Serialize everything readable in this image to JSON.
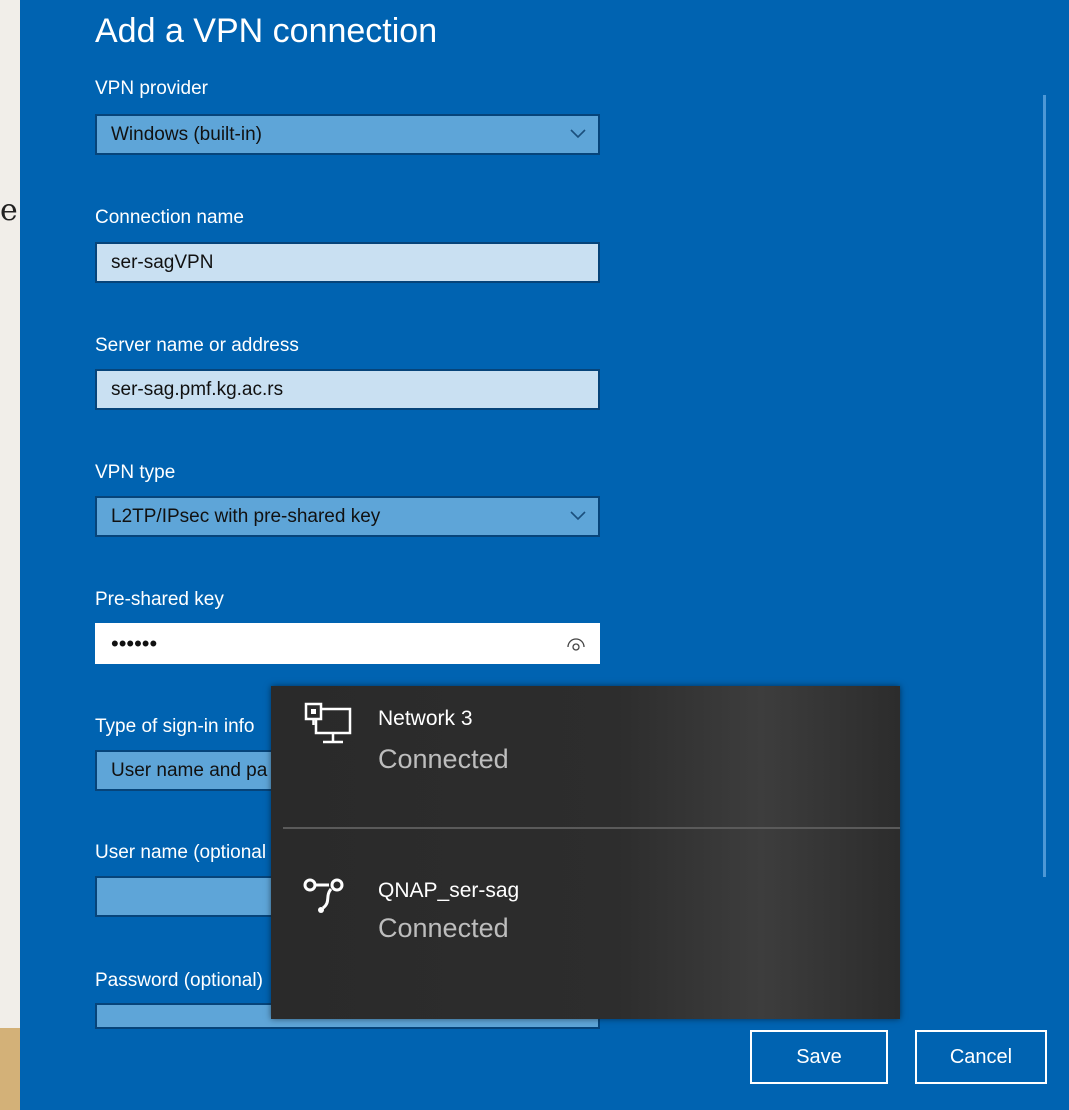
{
  "dialog": {
    "title": "Add a VPN connection",
    "fields": {
      "vpn_provider": {
        "label": "VPN provider",
        "value": "Windows (built-in)"
      },
      "connection_name": {
        "label": "Connection name",
        "value": "ser-sagVPN"
      },
      "server_name": {
        "label": "Server name or address",
        "value": "ser-sag.pmf.kg.ac.rs"
      },
      "vpn_type": {
        "label": "VPN type",
        "value": "L2TP/IPsec with pre-shared key"
      },
      "pre_shared_key": {
        "label": "Pre-shared key",
        "value": "••••••"
      },
      "sign_in_type": {
        "label": "Type of sign-in info",
        "value": "User name and pa"
      },
      "user_name": {
        "label": "User name (optional",
        "value": ""
      },
      "password": {
        "label": "Password (optional)",
        "value": ""
      }
    },
    "buttons": {
      "save": "Save",
      "cancel": "Cancel"
    }
  },
  "background": {
    "partial_letter": "e"
  },
  "network_flyout": {
    "networks": [
      {
        "name": "Network 3",
        "status": "Connected",
        "icon": "wired-network-icon"
      },
      {
        "name": "QNAP_ser-sag",
        "status": "Connected",
        "icon": "vpn-icon"
      }
    ]
  },
  "colors": {
    "dialog_background": "#0063b1",
    "flyout_background": "#2b2b2b"
  }
}
